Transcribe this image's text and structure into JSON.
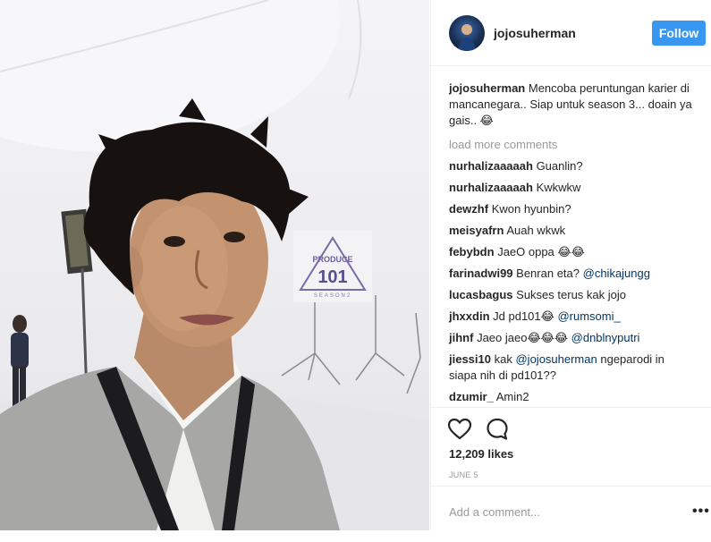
{
  "post": {
    "image_alt": "selfie photo"
  },
  "header": {
    "username": "jojosuherman",
    "follow_label": "Follow"
  },
  "caption": {
    "username": "jojosuherman",
    "text": "Mencoba peruntungan karier di mancanegara.. Siap untuk season 3... doain ya gais.. 😂"
  },
  "load_more_label": "load more comments",
  "comments": [
    {
      "username": "nurhalizaaaaah",
      "text": "Guanlin?",
      "mention": ""
    },
    {
      "username": "nurhalizaaaaah",
      "text": "Kwkwkw",
      "mention": ""
    },
    {
      "username": "dewzhf",
      "text": "Kwon hyunbin?",
      "mention": ""
    },
    {
      "username": "meisyafrn",
      "text": "Auah wkwk",
      "mention": ""
    },
    {
      "username": "febybdn",
      "text": "JaeO oppa 😂😂",
      "mention": ""
    },
    {
      "username": "farinadwi99",
      "text": "Benran eta?",
      "mention": "@chikajungg"
    },
    {
      "username": "lucasbagus",
      "text": "Sukses terus kak jojo",
      "mention": ""
    },
    {
      "username": "jhxxdin",
      "text": "Jd pd101😂",
      "mention": "@rumsomi_"
    },
    {
      "username": "jihnf",
      "text": "Jaeo jaeo😂😂😂",
      "mention": "@dnblnyputri"
    },
    {
      "username": "jiessi10",
      "text": "kak",
      "mention": "@jojosuherman",
      "text_after": "ngeparodi in siapa nih di pd101??"
    },
    {
      "username": "dzumir_",
      "text": "Amin2",
      "mention": ""
    }
  ],
  "actions": {
    "like_icon": "heart-icon",
    "comment_icon": "comment-bubble-icon"
  },
  "likes_label": "12,209 likes",
  "date_label": "JUNE 5",
  "add_comment": {
    "placeholder": "Add a comment...",
    "more_label": "•••"
  },
  "photo_sign": {
    "line1": "PRODUCE",
    "line2": "101",
    "line3": "SEASON2"
  }
}
